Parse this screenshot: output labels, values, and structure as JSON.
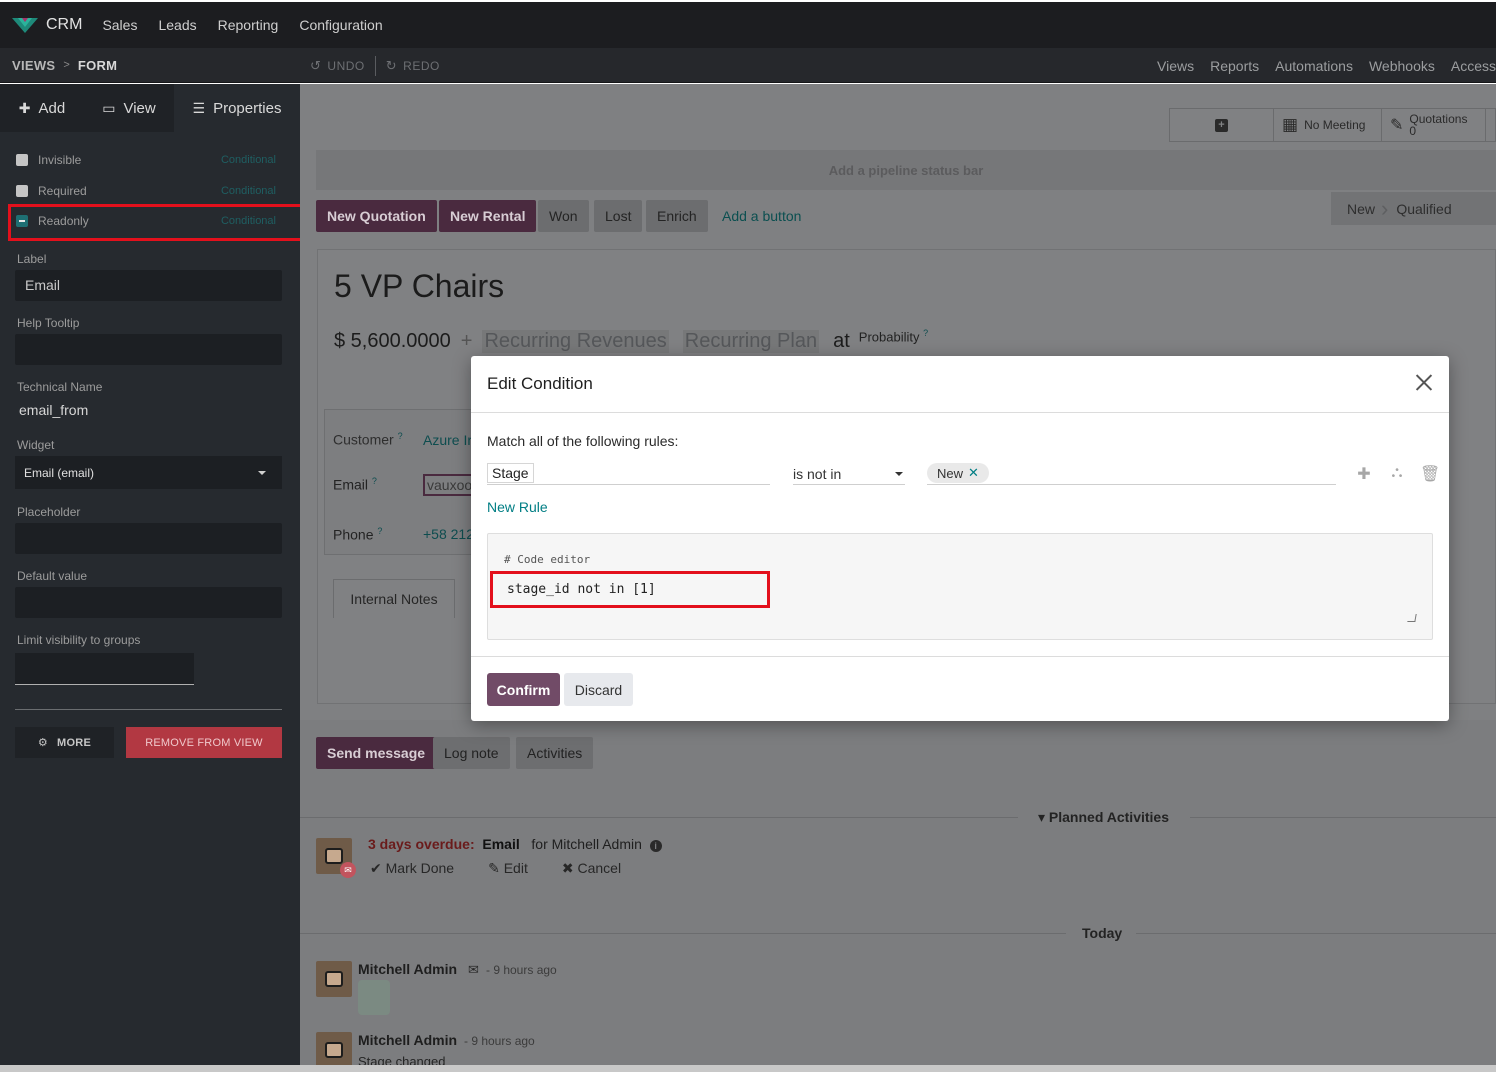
{
  "topbar": {
    "app_name": "CRM",
    "menu": [
      "Sales",
      "Leads",
      "Reporting",
      "Configuration"
    ]
  },
  "studiobar": {
    "crumb_views": "VIEWS",
    "crumb_sep": ">",
    "crumb_form": "FORM",
    "undo": "UNDO",
    "redo": "REDO",
    "right_links": [
      "Views",
      "Reports",
      "Automations",
      "Webhooks",
      "Access"
    ]
  },
  "sidebar": {
    "tabs": [
      "Add",
      "View",
      "Properties"
    ],
    "invisible": "Invisible",
    "required": "Required",
    "readonly": "Readonly",
    "conditional": "Conditional",
    "label_caption": "Label",
    "label_value": "Email",
    "help_caption": "Help Tooltip",
    "tech_caption": "Technical Name",
    "tech_value": "email_from",
    "widget_caption": "Widget",
    "widget_value": "Email (email)",
    "placeholder_caption": "Placeholder",
    "default_caption": "Default value",
    "groups_caption": "Limit visibility to groups",
    "more": "MORE",
    "remove": "REMOVE FROM VIEW"
  },
  "form": {
    "smart_meeting": "No Meeting",
    "smart_quotations": "Quotations",
    "smart_quotations_count": "0",
    "pipeline_placeholder": "Add a pipeline status bar",
    "btn_new_quotation": "New Quotation",
    "btn_new_rental": "New Rental",
    "btn_won": "Won",
    "btn_lost": "Lost",
    "btn_enrich": "Enrich",
    "add_button": "Add a button",
    "stage_new": "New",
    "stage_qualified": "Qualified",
    "title": "5 VP Chairs",
    "amount": "$ 5,600.0000",
    "plus": "+",
    "recurring_revenues": "Recurring Revenues",
    "recurring_plan": "Recurring Plan",
    "at": "at",
    "probability": "Probability",
    "q": "?",
    "customer_label": "Customer",
    "customer_value": "Azure Ir",
    "email_label": "Email",
    "email_value": "vauxoo",
    "phone_label": "Phone",
    "phone_value": "+58 212",
    "tab_internal_notes": "Internal Notes"
  },
  "chatter": {
    "send_message": "Send message",
    "log_note": "Log note",
    "activities": "Activities",
    "planned_activities": "Planned Activities",
    "overdue": "3 days overdue:",
    "activity_type": "Email",
    "activity_for": "for Mitchell Admin",
    "mark_done": "Mark Done",
    "edit": "Edit",
    "cancel": "Cancel",
    "today": "Today",
    "msg1_author": "Mitchell Admin",
    "msg1_time": "- 9 hours ago",
    "msg2_author": "Mitchell Admin",
    "msg2_time": "- 9 hours ago",
    "msg2_body": "Stage changed"
  },
  "dialog": {
    "title": "Edit Condition",
    "intro": "Match all of the following rules:",
    "rule_path": "Stage",
    "rule_operator": "is not in",
    "rule_value": "New",
    "new_rule": "New Rule",
    "code_comment": "# Code editor",
    "code": "stage_id not in [1]",
    "confirm": "Confirm",
    "discard": "Discard"
  },
  "colors": {
    "accent": "#714b67",
    "link": "#017e84",
    "highlight": "#e3101c"
  }
}
